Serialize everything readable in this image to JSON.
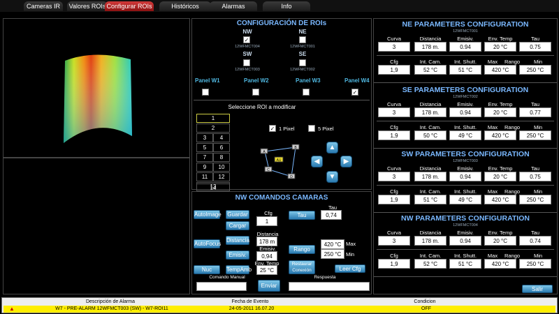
{
  "tabs": [
    {
      "label": "Cameras IR"
    },
    {
      "label": "Valores ROIs"
    },
    {
      "label": "Configurar ROIs"
    },
    {
      "label": "Históricos"
    },
    {
      "label": "Alarmas"
    },
    {
      "label": "Info"
    }
  ],
  "roi_config": {
    "title": "CONFIGURACIÓN DE ROIs",
    "rois": [
      {
        "label": "NW",
        "sub": "12WFMCT004",
        "checked": "✓"
      },
      {
        "label": "NE",
        "sub": "12WFMCT001",
        "checked": ""
      },
      {
        "label": "SW",
        "sub": "12WFMCT003",
        "checked": ""
      },
      {
        "label": "SE",
        "sub": "12WFMCT002",
        "checked": ""
      }
    ],
    "panels": [
      {
        "label": "Panel W1",
        "checked": ""
      },
      {
        "label": "Panel W2",
        "checked": ""
      },
      {
        "label": "Panel W3",
        "checked": ""
      },
      {
        "label": "Panel W4",
        "checked": "✓"
      }
    ]
  },
  "roi_select": {
    "title": "Seleccione ROI a modificar",
    "cells": [
      "1",
      "2",
      "3",
      "4",
      "5",
      "6",
      "7",
      "8",
      "9",
      "10",
      "11",
      "12",
      "13",
      "14"
    ],
    "pixel1": {
      "label": "1 Pixel",
      "checked": "✓"
    },
    "pixel5": {
      "label": "5 Pixel",
      "checked": ""
    },
    "diagram_labels": [
      "A",
      "B",
      "AU",
      "C",
      "D"
    ]
  },
  "commands": {
    "title": "NW   COMANDOS CAMARAS",
    "autoimage": "AutoImage",
    "autofocus": "AutoFocus",
    "nuc": "Nuc",
    "guardar": "Guardar",
    "cargar": "Cargar",
    "distancia_btn": "Distancia",
    "emisiv_btn": "Emisiv.",
    "tempamb_btn": "TempAmb",
    "cfg_label": "Cfg",
    "cfg_value": "1",
    "distancia_label": "Distancia",
    "distancia_value": "178 m",
    "emisiv_label": "Emisiv.",
    "emisiv_value": "0,94",
    "envtemp_label": "Env. Temp",
    "envtemp_value": "25 °C",
    "tau_label": "Tau",
    "tau_value": "0,74",
    "tau_btn": "Tau",
    "rango_btn": "Rango",
    "max_value": "420 °C",
    "min_value": "250 °C",
    "max_label": "Max",
    "min_label": "Min",
    "restaurar_btn": "Restaurar Conexión",
    "leer_cfg_btn": "Leer Cfg",
    "comando_manual_label": "Comando Manual",
    "enviar_btn": "Enviar",
    "respuesta_label": "Respuesta"
  },
  "param_sections": [
    {
      "title": "NE PARAMETERS CONFIGURATION",
      "sub": "12WFMCT001",
      "row1_labels": [
        "Curva",
        "Distancia",
        "Emisiv.",
        "Env. Temp",
        "Tau"
      ],
      "row1_values": [
        "3",
        "178 m.",
        "0.94",
        "20 °C",
        "0.75"
      ],
      "row2_labels": [
        "Cfg",
        "Int. Cam.",
        "Int. Shutt.",
        "Max",
        "Rango",
        "Min"
      ],
      "row2_values": [
        "1,9",
        "52 °C",
        "51 °C",
        "420 °C",
        "250 °C"
      ]
    },
    {
      "title": "SE PARAMETERS CONFIGURATION",
      "sub": "12WFMCT002",
      "row1_labels": [
        "Curva",
        "Distancia",
        "Emisiv.",
        "Env. Temp",
        "Tau"
      ],
      "row1_values": [
        "3",
        "178 m.",
        "0.94",
        "20 °C",
        "0.77"
      ],
      "row2_labels": [
        "Cfg",
        "Int. Cam.",
        "Int. Shutt.",
        "Max",
        "Rango",
        "Min"
      ],
      "row2_values": [
        "1,9",
        "50 °C",
        "49 °C",
        "420 °C",
        "250 °C"
      ]
    },
    {
      "title": "SW PARAMETERS CONFIGURATION",
      "sub": "12WFMCT003",
      "row1_labels": [
        "Curva",
        "Distancia",
        "Emisiv.",
        "Env. Temp",
        "Tau"
      ],
      "row1_values": [
        "3",
        "178 m.",
        "0.94",
        "20 °C",
        "0.75"
      ],
      "row2_labels": [
        "Cfg",
        "Int. Cam.",
        "Int. Shutt.",
        "Max",
        "Rango",
        "Min"
      ],
      "row2_values": [
        "1,9",
        "51 °C",
        "49 °C",
        "420 °C",
        "250 °C"
      ]
    },
    {
      "title": "NW PARAMETERS CONFIGURATION",
      "sub": "12WFMCT004",
      "row1_labels": [
        "Curva",
        "Distancia",
        "Emisiv.",
        "Env. Temp",
        "Tau"
      ],
      "row1_values": [
        "3",
        "178 m.",
        "0.94",
        "20 °C",
        "0.74"
      ],
      "row2_labels": [
        "Cfg",
        "Int. Cam.",
        "Int. Shutt.",
        "Max",
        "Rango",
        "Min"
      ],
      "row2_values": [
        "1,9",
        "52 °C",
        "51 °C",
        "420 °C",
        "250 °C"
      ]
    }
  ],
  "salir": "Salir",
  "alarms": {
    "headers": [
      "Descripción de Alarma",
      "Fecha de Evento",
      "Condicion"
    ],
    "row": {
      "description": "W7 - PRE-ALARM 12WFMCT003 (SW) - W7-ROI11",
      "date": "24-05-2011 16.07.20",
      "condition": "OFF"
    },
    "colors": {
      "row_bg": "#ffee00",
      "warning_icon": "#cc0000"
    }
  }
}
